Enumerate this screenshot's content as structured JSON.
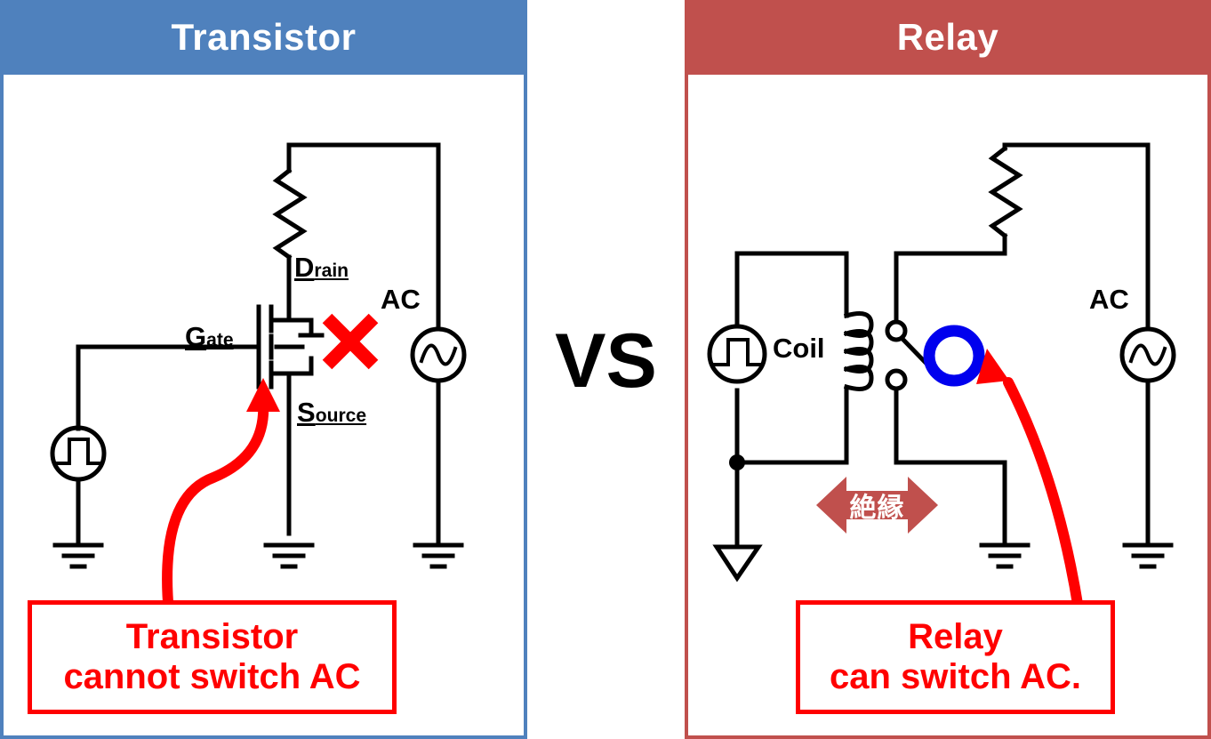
{
  "page": {
    "vs_label": "VS",
    "background": "#ffffff"
  },
  "colors": {
    "transistor_accent": "#4f81bd",
    "relay_accent": "#c0504d",
    "annotation_red": "#ff0000",
    "ok_mark_blue": "#0000ee",
    "wire_black": "#000000"
  },
  "panels": {
    "transistor": {
      "title": "Transistor",
      "accent": "#4f81bd",
      "labels": {
        "drain_lead": "D",
        "drain_rest": "rain",
        "gate_lead": "G",
        "gate_rest": "ate",
        "source_lead": "S",
        "source_rest": "ource",
        "ac": "AC"
      },
      "marks": {
        "verdict": "x-mark",
        "verdict_color": "#ff0000"
      },
      "callout": {
        "line1": "Transistor",
        "line2": "cannot switch AC"
      }
    },
    "relay": {
      "title": "Relay",
      "accent": "#c0504d",
      "labels": {
        "coil": "Coil",
        "ac": "AC"
      },
      "isolation": {
        "text": "絶縁",
        "color": "#c0504d",
        "text_color": "#ffffff"
      },
      "marks": {
        "verdict": "o-mark",
        "verdict_color": "#0000ee"
      },
      "callout": {
        "line1": "Relay",
        "line2": "can switch AC."
      }
    }
  },
  "chart_data": {
    "type": "diagram",
    "title": "Transistor vs Relay AC switching comparison",
    "left_circuit": {
      "name": "Transistor (N-channel MOSFET) switching circuit",
      "components": [
        "pulse-voltage-source",
        "earth-ground",
        "n-channel-mosfet",
        "load-resistor",
        "ac-voltage-source",
        "earth-ground"
      ],
      "result": "cannot switch AC"
    },
    "right_circuit": {
      "name": "Relay switching circuit",
      "components": [
        "pulse-voltage-source",
        "signal-ground",
        "relay-coil",
        "relay-contacts-spst",
        "load-resistor",
        "ac-voltage-source",
        "earth-ground"
      ],
      "result": "can switch AC",
      "isolation_note": "絶縁"
    }
  }
}
